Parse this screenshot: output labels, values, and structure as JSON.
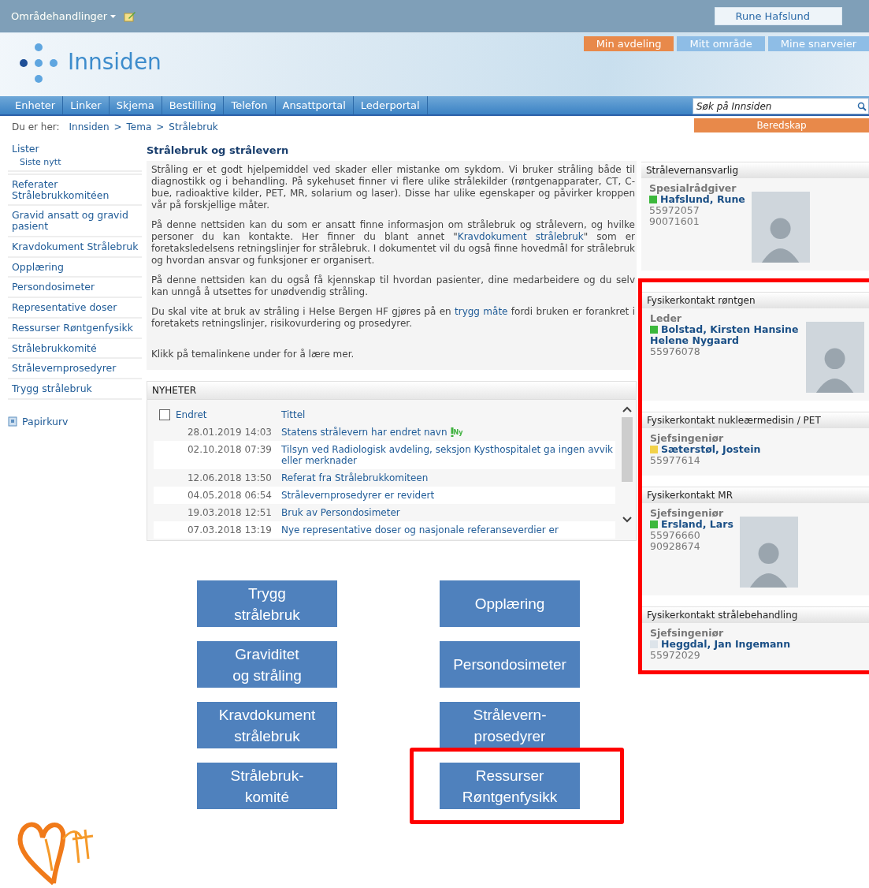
{
  "top_bar": {
    "site_actions": "Områdehandlinger",
    "user": "Rune Hafslund"
  },
  "logo": {
    "title": "Innsiden"
  },
  "quick_links": [
    {
      "label": "Min avdeling",
      "selected": true
    },
    {
      "label": "Mitt område",
      "selected": false
    },
    {
      "label": "Mine snarveier",
      "selected": false
    }
  ],
  "nav_tabs": [
    {
      "label": "Enheter"
    },
    {
      "label": "Linker"
    },
    {
      "label": "Skjema"
    },
    {
      "label": "Bestilling"
    },
    {
      "label": "Telefon"
    },
    {
      "label": "Ansattportal"
    },
    {
      "label": "Lederportal"
    }
  ],
  "search": {
    "placeholder": "Søk på Innsiden"
  },
  "breadcrumb": {
    "label": "Du er her:",
    "separator": ">",
    "items": [
      "Innsiden",
      "Tema",
      "Strålebruk"
    ]
  },
  "emergency_button": "Beredskap",
  "sidebar": {
    "items": [
      {
        "label": "Lister",
        "children": [
          {
            "label": "Siste nytt"
          }
        ]
      },
      {
        "label": "Referater Strålebrukkomitéen"
      },
      {
        "label": "Gravid ansatt og gravid pasient"
      },
      {
        "label": "Kravdokument Strålebruk"
      },
      {
        "label": "Opplæring"
      },
      {
        "label": "Persondosimeter"
      },
      {
        "label": "Representative doser"
      },
      {
        "label": "Ressurser Røntgenfysikk"
      },
      {
        "label": "Strålebrukkomité"
      },
      {
        "label": "Strålevernprosedyrer"
      },
      {
        "label": "Trygg strålebruk"
      }
    ],
    "recycle_bin": "Papirkurv"
  },
  "article": {
    "title": "Strålebruk og strålevern",
    "paragraphs": [
      [
        {
          "text": "Stråling er et godt hjelpemiddel ved skader eller mistanke om sykdom. Vi bruker stråling både til diagnostikk og i behandling. På sykehuset finner vi flere ulike strålekilder (røntgenapparater, CT, C-bue, radioaktive kilder, PET, MR, solarium og laser). Disse har ulike egenskaper og påvirker kroppen vår på forskjellige måter."
        }
      ],
      [
        {
          "text": "På denne nettsiden kan du som er ansatt finne informasjon om strålebruk og strålevern, og hvilke personer du kan kontakte. Her finner du blant annet \""
        },
        {
          "link": "Kravdokument strålebruk"
        },
        {
          "text": "\" som er foretaksledelsens retningslinjer for strålebruk. I dokumentet vil du også finne hovedmål for strålebruk og hvordan ansvar og funksjoner er organisert."
        }
      ],
      [
        {
          "text": "På denne nettsiden kan du også få kjennskap til hvordan pasienter, dine medarbeidere og du selv kan unngå å utsettes for unødvendig stråling."
        }
      ],
      [
        {
          "text": "Du skal vite at bruk av stråling i Helse Bergen HF gjøres på en "
        },
        {
          "link": "trygg måte"
        },
        {
          "text": " fordi bruken er forankret i foretakets retningslinjer, risikovurdering og prosedyrer."
        }
      ],
      [
        {
          "text": "Klikk på temalinkene under for å lære mer."
        }
      ]
    ]
  },
  "news": {
    "title": "NYHETER",
    "select_all": {
      "checked": false
    },
    "columns": [
      "Endret",
      "Tittel"
    ],
    "rows": [
      {
        "changed": "28.01.2019 14:03",
        "title": "Statens strålevern har endret navn",
        "new_badge": "Ny"
      },
      {
        "changed": "02.10.2018 07:39",
        "title": "Tilsyn ved Radiologisk avdeling, seksjon Kysthospitalet ga ingen avvik eller merknader"
      },
      {
        "changed": "12.06.2018 13:50",
        "title": "Referat fra Strålebrukkomiteen"
      },
      {
        "changed": "04.05.2018 06:54",
        "title": "Strålevernprosedyrer er revidert"
      },
      {
        "changed": "19.03.2018 12:51",
        "title": "Bruk av Persondosimeter"
      },
      {
        "changed": "07.03.2018 13:19",
        "title": "Nye representative doser og nasjonale referanseverdier er"
      }
    ]
  },
  "tiles": [
    {
      "label": "Trygg\nstrålebruk",
      "highlighted": false
    },
    {
      "label": "Opplæring",
      "highlighted": false
    },
    {
      "label": "Graviditet\nog stråling",
      "highlighted": false
    },
    {
      "label": "Persondosimeter",
      "highlighted": false
    },
    {
      "label": "Kravdokument\nstrålebruk",
      "highlighted": false
    },
    {
      "label": "Strålevern-\nprosedyrer",
      "highlighted": false
    },
    {
      "label": "Strålebruk-\nkomité",
      "highlighted": false
    },
    {
      "label": "Ressurser\nRøntgenfysikk",
      "highlighted": true
    }
  ],
  "contacts": [
    {
      "title": "Strålevernansvarlig",
      "highlighted": false,
      "role": "Spesialrådgiver",
      "name": "Hafslund, Rune",
      "color": "#3cb83c",
      "phones": [
        "55972057",
        "90071601"
      ],
      "photo": true
    },
    {
      "title": "Fysikerkontakt røntgen",
      "highlighted": true,
      "role": "Leder",
      "name": "Bolstad, Kirsten Hansine Helene Nygaard",
      "color": "#3cb83c",
      "phones": [
        "55976078"
      ],
      "photo": true
    },
    {
      "title": "Fysikerkontakt nukleærmedisin / PET",
      "highlighted": true,
      "role": "Sjefsingeniør",
      "name": "Sæterstøl, Jostein",
      "color": "#f2d24a",
      "phones": [
        "55977614"
      ],
      "photo": false
    },
    {
      "title": "Fysikerkontakt MR",
      "highlighted": true,
      "role": "Sjefsingeniør",
      "name": "Ersland, Lars",
      "color": "#3cb83c",
      "phones": [
        "55976660",
        "90928674"
      ],
      "photo": true
    },
    {
      "title": "Fysikerkontakt strålebehandling",
      "highlighted": true,
      "role": "Sjefsingeniør",
      "name": "Heggdal, Jan Ingemann",
      "color": "#dde4ea",
      "phones": [
        "55972029"
      ],
      "photo": false
    }
  ]
}
